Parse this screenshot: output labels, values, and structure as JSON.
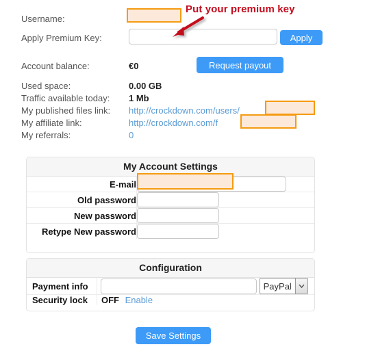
{
  "account_info": {
    "username_label": "Username:",
    "username_value_redacted": "",
    "premium_key_label": "Apply Premium Key:",
    "premium_key_value": "",
    "premium_key_placeholder": "",
    "apply_button": "Apply",
    "balance_label": "Account balance:",
    "balance_value": "€0",
    "request_payout_button": "Request payout",
    "used_space_label": "Used space:",
    "used_space_value": "0.00 GB",
    "traffic_label": "Traffic available today:",
    "traffic_value": "1 Mb",
    "published_link_label": "My published files link:",
    "published_link_value": "http://crockdown.com/users/",
    "affiliate_link_label": "My affiliate link:",
    "affiliate_link_value": "http://crockdown.com/f",
    "referrals_label": "My referrals:",
    "referrals_value": "0"
  },
  "annotation": {
    "text": "Put your premium key",
    "color": "#c40d1e"
  },
  "account_settings": {
    "title": "My Account Settings",
    "rows": [
      {
        "label": "E-mail",
        "value": ""
      },
      {
        "label": "Old password",
        "value": ""
      },
      {
        "label": "New password",
        "value": ""
      },
      {
        "label": "Retype New password",
        "value": ""
      }
    ]
  },
  "configuration": {
    "title": "Configuration",
    "payment_info_label": "Payment info",
    "payment_info_value": "",
    "payment_method_selected": "PayPal",
    "payment_method_options": [
      "PayPal"
    ],
    "security_lock_label": "Security lock",
    "security_lock_state": "OFF",
    "security_lock_action": "Enable"
  },
  "footer": {
    "save_button": "Save Settings"
  },
  "colors": {
    "accent_blue": "#3d9bf7",
    "link_blue": "#5b9bd5",
    "redaction_border": "#f59b10",
    "redaction_fill": "#fce9d9",
    "annotation_red": "#c40d1e"
  }
}
